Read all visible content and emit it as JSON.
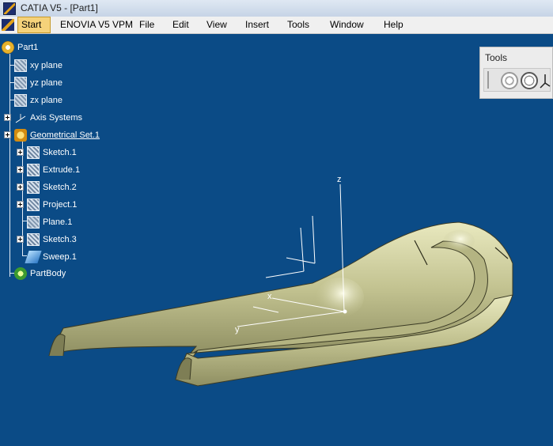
{
  "window": {
    "title": "CATIA V5 - [Part1]"
  },
  "menubar": {
    "items": [
      {
        "label": "Start",
        "active": true
      },
      {
        "label": "ENOVIA V5 VPM"
      },
      {
        "label": "File"
      },
      {
        "label": "Edit"
      },
      {
        "label": "View"
      },
      {
        "label": "Insert"
      },
      {
        "label": "Tools"
      },
      {
        "label": "Window"
      },
      {
        "label": "Help"
      }
    ]
  },
  "tree": {
    "root": "Part1",
    "xy_plane": "xy plane",
    "yz_plane": "yz plane",
    "zx_plane": "zx plane",
    "axis_systems": "Axis Systems",
    "geometrical_set": "Geometrical Set.1",
    "sketch1": "Sketch.1",
    "extrude1": "Extrude.1",
    "sketch2": "Sketch.2",
    "project1": "Project.1",
    "plane1": "Plane.1",
    "sketch3": "Sketch.3",
    "sweep1": "Sweep.1",
    "partbody": "PartBody"
  },
  "tools": {
    "title": "Tools"
  },
  "axes": {
    "x": "x",
    "y": "y",
    "z": "z"
  },
  "colors": {
    "background": "#0b4b86",
    "surface": "#c2c290",
    "menu_active": "#f5d27a"
  }
}
